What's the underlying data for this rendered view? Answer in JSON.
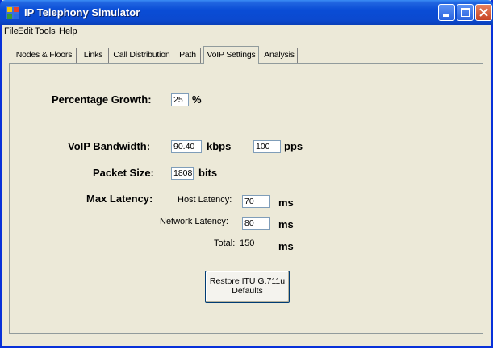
{
  "window": {
    "title": "IP Telephony Simulator"
  },
  "menu": [
    "File",
    "Edit",
    "Tools",
    "Help"
  ],
  "tabs": [
    {
      "label": "Nodes & Floors",
      "active": false
    },
    {
      "label": "Links",
      "active": false
    },
    {
      "label": "Call Distribution",
      "active": false
    },
    {
      "label": "Path",
      "active": false
    },
    {
      "label": "VoIP Settings",
      "active": true
    },
    {
      "label": "Analysis",
      "active": false
    }
  ],
  "form": {
    "percentage_growth": {
      "label": "Percentage Growth:",
      "value": "25",
      "unit": "%"
    },
    "voip_bandwidth": {
      "label": "VoIP Bandwidth:",
      "kbps_value": "90.40",
      "kbps_unit": "kbps",
      "pps_value": "100",
      "pps_unit": "pps"
    },
    "packet_size": {
      "label": "Packet Size:",
      "value": "1808",
      "unit": "bits"
    },
    "max_latency": {
      "label": "Max Latency:",
      "host_label": "Host Latency:",
      "host_value": "70",
      "host_unit": "ms",
      "network_label": "Network Latency:",
      "network_value": "80",
      "network_unit": "ms",
      "total_label": "Total:",
      "total_value": "150",
      "total_unit": "ms"
    },
    "restore_button": {
      "line1": "Restore ITU G.711u",
      "line2": "Defaults"
    }
  },
  "colors": {
    "titlebar": "#0a4dd6",
    "window_bg": "#ece9d8",
    "frame": "#0831d9"
  },
  "icons": {
    "app": "app-grid-icon",
    "minimize": "minimize-icon",
    "maximize": "maximize-icon",
    "close": "close-icon"
  }
}
